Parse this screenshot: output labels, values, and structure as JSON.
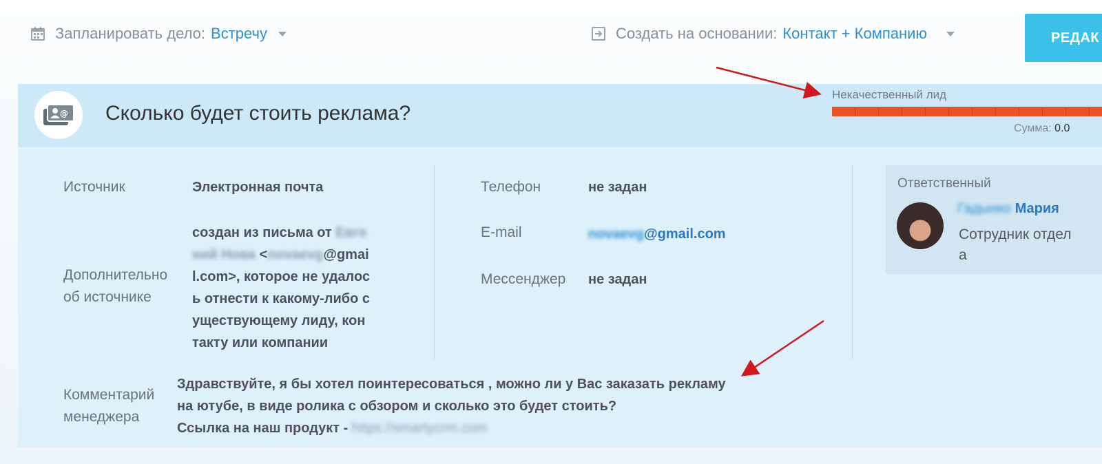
{
  "toolbar": {
    "schedule_label": "Запланировать дело:",
    "schedule_value": "Встречу",
    "create_label": "Создать на основании:",
    "create_value": "Контакт + Компанию",
    "edit_label": "РЕДАК"
  },
  "lead": {
    "title": "Сколько будет стоить реклама?",
    "stage_label": "Некачественный лид",
    "sum_label": "Сумма:",
    "sum_value": "0.0"
  },
  "fields": {
    "source_label": "Источник",
    "source_value": "Электронная почта",
    "extra_label_1": "Дополнительно",
    "extra_label_2": "об источнике",
    "extra_lines": [
      "создан из письма от ",
      " <",
      "@gmai",
      "l.com>, которое не удалос",
      "ь отнести к какому-либо с",
      "уществующему лиду, кон",
      "такту или компании"
    ],
    "extra_blur_1": "Евге",
    "extra_blur_2": "ний Нова",
    "extra_blur_3": "novaevg",
    "phone_label": "Телефон",
    "phone_value": "не задан",
    "email_label": "E-mail",
    "email_blur": "novaevg",
    "email_domain": "@gmail.com",
    "messenger_label": "Мессенджер",
    "messenger_value": "не задан",
    "comment_label_1": "Комментарий",
    "comment_label_2": "менеджера",
    "comment_line_1": "Здравствуйте, я бы хотел поинтересоваться , можно ли у Вас заказать рекламу",
    "comment_line_2": "на ютубе, в виде ролика с обзором и сколько это будет стоить?",
    "comment_line_3": "Ссылка на наш продукт - ",
    "comment_link_blur": "https://smartycrm.com"
  },
  "responsible": {
    "label": "Ответственный",
    "surname_blur": "Гадынко",
    "name": "Мария",
    "role_1": "Сотрудник отдел",
    "role_2": "а"
  },
  "colors": {
    "accent": "#2d8fd5",
    "edit_button": "#3bc0ea",
    "stage_bar": "#ea5424",
    "header_band": "#cde8f6",
    "details_panel": "#def0fa",
    "annotation_arrow": "#d0181e"
  }
}
